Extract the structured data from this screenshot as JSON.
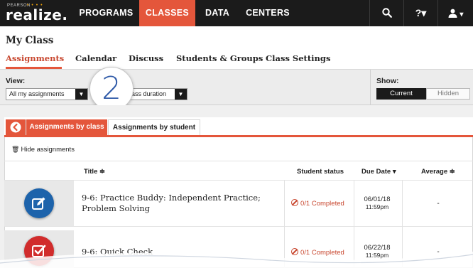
{
  "nav": {
    "brand_small": "PEARSON",
    "brand_dots": "• • • •",
    "brand_name": "realize.",
    "items": [
      "PROGRAMS",
      "CLASSES",
      "DATA",
      "CENTERS"
    ],
    "active": "CLASSES",
    "search_glyph": "🔍",
    "help_label": "?▾",
    "user_label": "▾"
  },
  "page": {
    "title": "My Class",
    "tabs": [
      "Assignments",
      "Calendar",
      "Discuss",
      "Students & Groups",
      "Class Settings"
    ]
  },
  "filters": {
    "view_label": "View:",
    "view_value": "All my assignments",
    "duration_value": "ass duration",
    "show_label": "Show:",
    "show_options": [
      "Current",
      "Hidden"
    ]
  },
  "annotation": {
    "number": "2"
  },
  "content_tabs": [
    "Assignments by class",
    "Assignments by student"
  ],
  "hide_assignments": "Hide assignments",
  "table": {
    "headers": {
      "title": "Title ≑",
      "status": "Student status",
      "due": "Due Date ▾",
      "average": "Average ≑"
    },
    "rows": [
      {
        "title_line1": "9-6: Practice Buddy: Independent Practice;",
        "title_line2": "Problem Solving",
        "status": "0/1 Completed",
        "due_date": "06/01/18",
        "due_time": "11:59pm",
        "average": "-"
      },
      {
        "title_line1": "9-6: Quick Check",
        "title_line2": "",
        "status": "0/1 Completed",
        "due_date": "06/22/18",
        "due_time": "11:59pm",
        "average": "-"
      }
    ]
  },
  "colors": {
    "nav_bg": "#1b1b1b",
    "accent": "#e4563b",
    "badge_blue": "#1d63ab",
    "badge_red": "#d12c2c"
  }
}
